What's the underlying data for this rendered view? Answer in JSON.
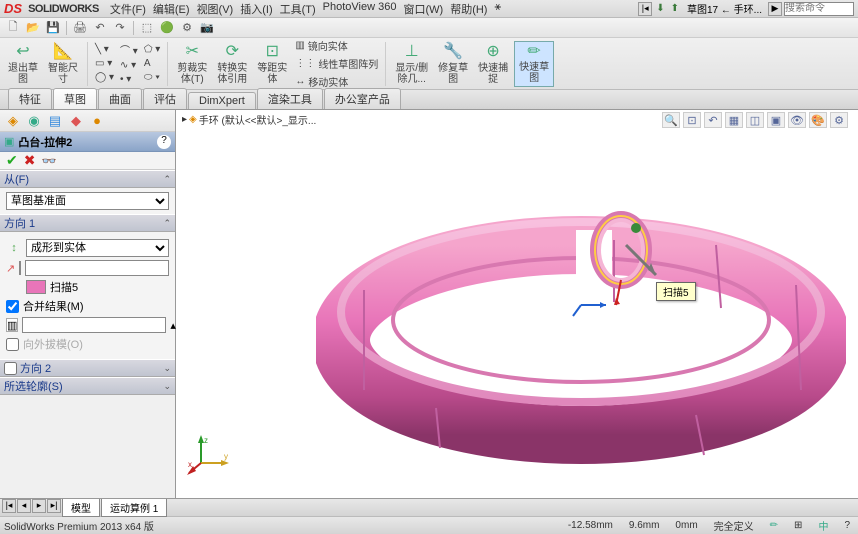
{
  "app": {
    "name": "SOLIDWORKS"
  },
  "menus": [
    "文件(F)",
    "编辑(E)",
    "视图(V)",
    "插入(I)",
    "工具(T)",
    "PhotoView 360",
    "窗口(W)",
    "帮助(H)"
  ],
  "title_nav": {
    "doc": "草图17 ← 手环...",
    "search_placeholder": "搜索命令"
  },
  "ribbon": {
    "exit_sketch": "退出草\n图",
    "smart_dim": "智能尺\n寸",
    "trim": "剪裁实\n体(T)",
    "convert": "转换实\n体引用",
    "offset": "等距实\n体",
    "mirror": "镜向实体",
    "linear_pattern": "线性草图阵列",
    "move": "移动实体",
    "display_delete": "显示/删\n除几...",
    "repair": "修复草\n图",
    "rapid_sketch": "快速捕\n捉",
    "rapid_sketch2": "快速草\n图"
  },
  "tabs": [
    "特征",
    "草图",
    "曲面",
    "评估",
    "DimXpert",
    "渲染工具",
    "办公室产品"
  ],
  "active_tab": "草图",
  "breadcrumb": "手环 (默认<<默认>_显示...",
  "pm": {
    "title": "凸台-拉伸2",
    "from_label": "从(F)",
    "from_value": "草图基准面",
    "dir1_label": "方向 1",
    "dir1_type": "成形到实体",
    "body_name": "扫描5",
    "merge": "合并结果(M)",
    "draft_out": "向外拔模(O)",
    "dir2_label": "方向 2",
    "sel_contours": "所选轮廓(S)"
  },
  "callout": "扫描5",
  "bottom_tabs": [
    "模型",
    "运动算例 1"
  ],
  "status": {
    "version": "SolidWorks Premium 2013 x64 版",
    "x": "-12.58mm",
    "y": "9.6mm",
    "z": "0mm",
    "def": "完全定义"
  }
}
